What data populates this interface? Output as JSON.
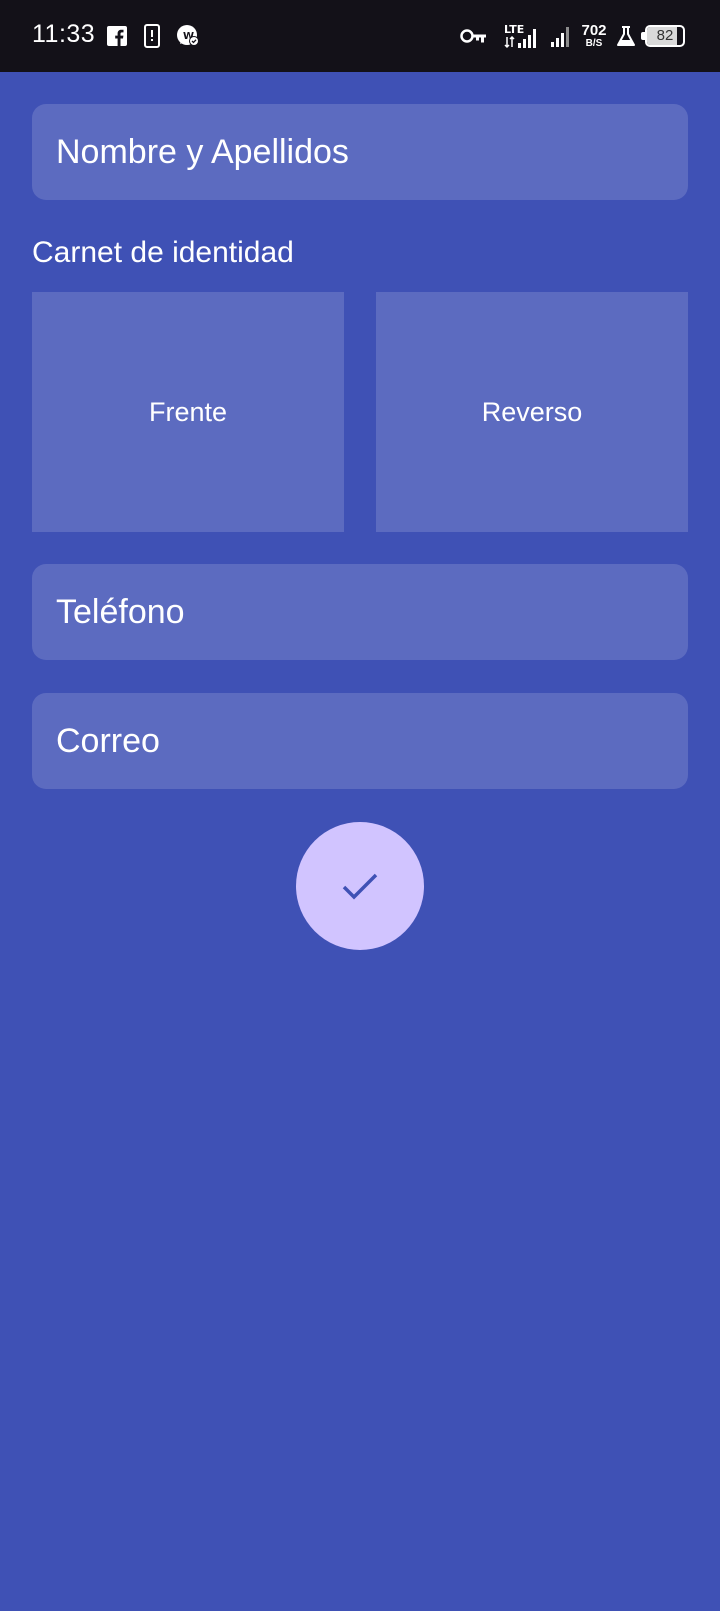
{
  "status_bar": {
    "time": "11:33",
    "icons_left": [
      "facebook-icon",
      "phone-alert-icon",
      "whatsapp-business-icon"
    ],
    "icons_right": [
      "vpn-key-icon",
      "lte-signal-icon",
      "signal-icon",
      "lab-flask-icon"
    ],
    "network_type": "LTE",
    "net_speed_value": "702",
    "net_speed_unit": "B/S",
    "battery_level": "82"
  },
  "form": {
    "name_placeholder": "Nombre y Apellidos",
    "id_section_label": "Carnet de identidad",
    "id_front_label": "Frente",
    "id_back_label": "Reverso",
    "phone_placeholder": "Teléfono",
    "email_placeholder": "Correo",
    "submit_icon": "check-icon"
  },
  "colors": {
    "background": "#3f51b5",
    "field_background": "#5c6bc0",
    "status_bar": "#131118",
    "fab_background": "#d1c4ff",
    "fab_icon": "#3f51b5"
  }
}
